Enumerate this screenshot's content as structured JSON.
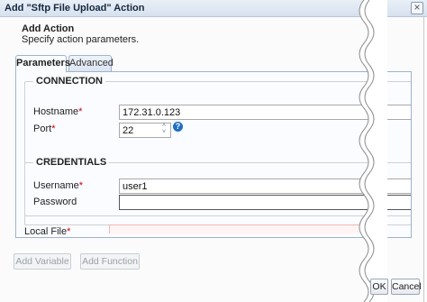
{
  "window": {
    "title": "Add \"Sftp File Upload\" Action",
    "close_glyph": "×"
  },
  "header": {
    "title": "Add Action",
    "subtitle": "Specify action parameters."
  },
  "tabs": [
    {
      "label": "Parameters",
      "active": true
    },
    {
      "label": "Advanced",
      "active": false
    }
  ],
  "connection": {
    "legend": "CONNECTION",
    "hostname_label": "Hostname",
    "hostname_value": "172.31.0.123",
    "port_label": "Port",
    "port_value": "22",
    "help_glyph": "?"
  },
  "credentials": {
    "legend": "CREDENTIALS",
    "username_label": "Username",
    "username_value": "user1",
    "password_label": "Password",
    "password_value": ""
  },
  "local_file": {
    "label": "Local File"
  },
  "required_mark": "*",
  "stepper": {
    "up": "˄",
    "down": "˅"
  },
  "footer": {
    "add_variable": "Add Variable",
    "add_function": "Add Function",
    "ok": "OK",
    "cancel": "Cancel"
  },
  "colors": {
    "required": "#d00000",
    "help": "#1f6fc4",
    "tab_border": "#9eb3ce"
  }
}
